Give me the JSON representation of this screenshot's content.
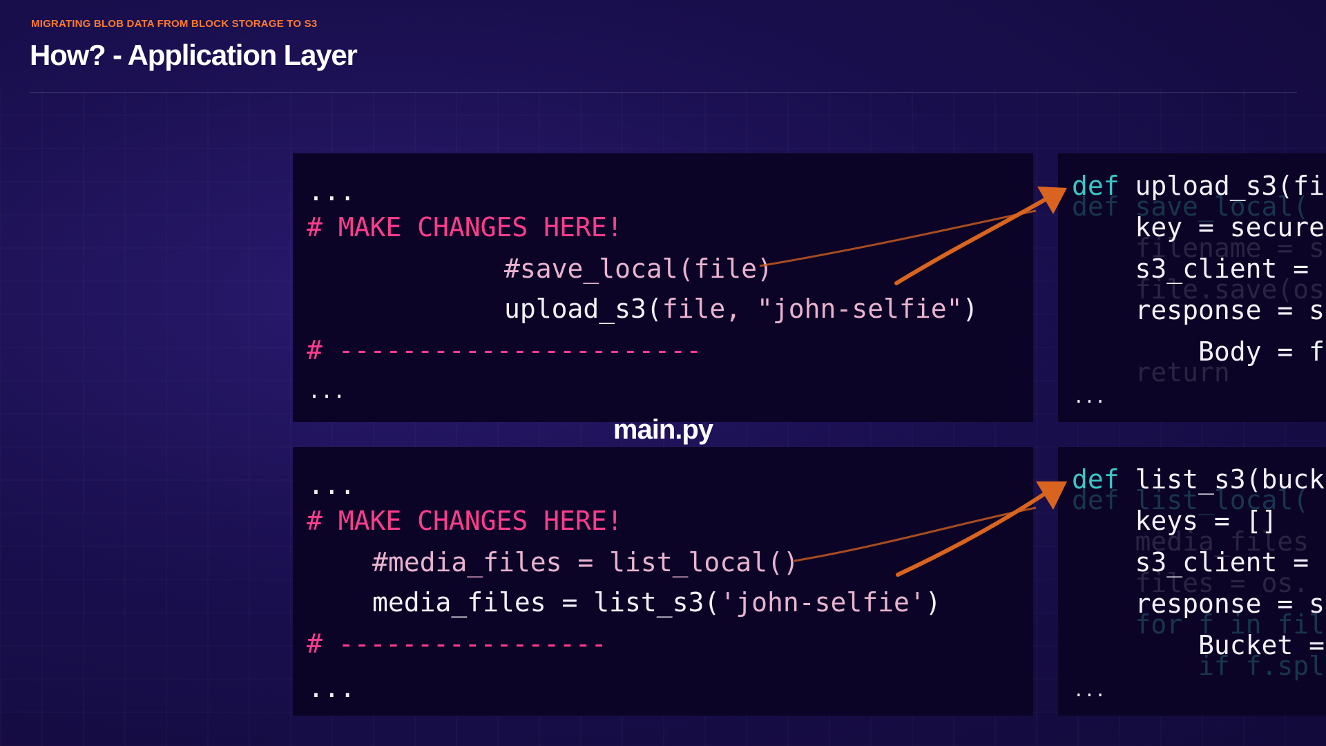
{
  "header": {
    "subtitle": "MIGRATING BLOB DATA FROM BLOCK STORAGE TO S3",
    "title": "How? - Application Layer"
  },
  "caption": "main.py",
  "top_code": {
    "ellipsis_top": "...",
    "comment_start": "# MAKE CHANGES HERE!",
    "old_call": "#save_local(file)",
    "new_call_a": "upload_s3(",
    "new_call_b": "file, \"john-selfie\"",
    "new_call_c": ")",
    "comment_end": "# -----------------------",
    "ellipsis_bottom": "..."
  },
  "bottom_code": {
    "ellipsis_top": "...",
    "comment_start": "# MAKE CHANGES HERE!",
    "old_call": "#media_files = list_local()",
    "new_call_a": "media_files = list_s3(",
    "new_call_b": "'john-selfie'",
    "new_call_c": ")",
    "comment_end": "# -----------------",
    "ellipsis_bottom": "..."
  },
  "right_top_code": {
    "l1_kw": "def",
    "l1_rest": " upload_s3(fi",
    "g1": "def save_local(",
    "l2": "    key = secure",
    "g2": "    filename = s",
    "l3": "    s3_client = ",
    "g3": "    file.save(os",
    "l4": "    response = s",
    "l5": "        Body = f",
    "g5": "    return",
    "ellipsis": "..."
  },
  "right_bottom_code": {
    "l1_kw": "def",
    "l1_rest": " list_s3(buck",
    "g1": "def list_local(",
    "l2": "    keys = []",
    "g2": "    media_files ",
    "l3": "    s3_client = ",
    "g3": "    files = os.",
    "l4": "    response = s",
    "g4": "    for f in fil",
    "l5": "        Bucket =",
    "g5": "        if f.spl",
    "ellipsis": "..."
  },
  "colors": {
    "background": "#1a0f4f",
    "panel": "#0c0426",
    "comment": "#ff3d8e",
    "keyword": "#3cc6c6",
    "accent": "#ff7a2f",
    "arrow": "#d9641f"
  }
}
